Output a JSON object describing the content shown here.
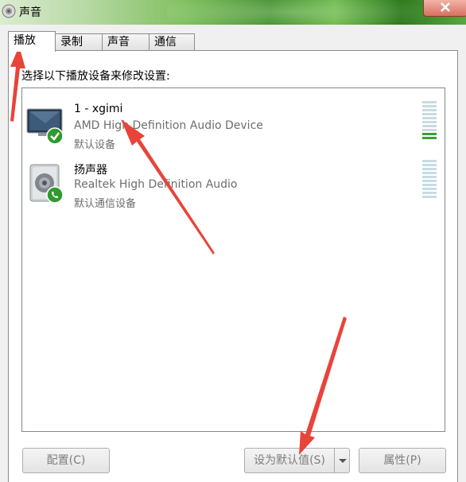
{
  "window": {
    "title": "声音"
  },
  "tabs": [
    {
      "label": "播放",
      "active": true
    },
    {
      "label": "录制",
      "active": false
    },
    {
      "label": "声音",
      "active": false
    },
    {
      "label": "通信",
      "active": false
    }
  ],
  "instruction": "选择以下播放设备来修改设置:",
  "devices": [
    {
      "name": "1 - xgimi",
      "description": "AMD High Definition Audio Device",
      "status": "默认设备",
      "icon": "monitor-icon",
      "badge": "default-check-icon",
      "level": 0.2
    },
    {
      "name": "扬声器",
      "description": "Realtek High Definition Audio",
      "status": "默认通信设备",
      "icon": "speaker-icon",
      "badge": "phone-badge-icon",
      "level": 0
    }
  ],
  "buttons": {
    "configure": "配置(C)",
    "set_default": "设为默认值(S)",
    "properties": "属性(P)"
  },
  "colors": {
    "annotation_arrow": "#e8443a",
    "badge_green": "#2f9a2f",
    "meter_on": "#3c9e3c",
    "meter_off": "#c7dbe3"
  }
}
